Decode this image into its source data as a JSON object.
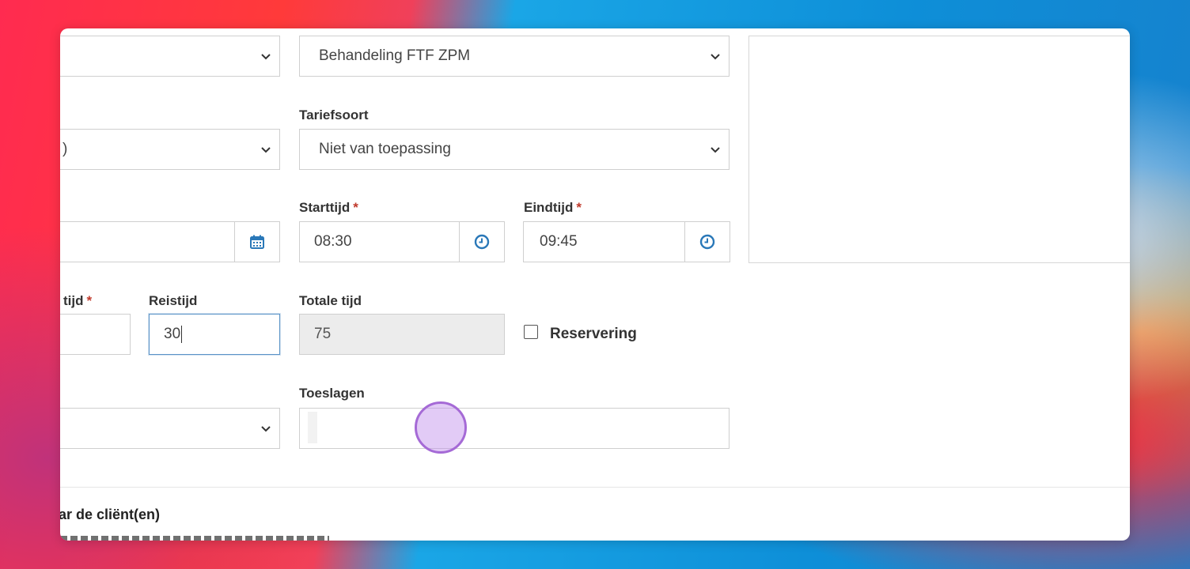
{
  "form": {
    "row1": {
      "left_select_value": "",
      "activity_select_value": "Behandeling FTF ZPM"
    },
    "row2": {
      "tariff_label": "Tariefsoort",
      "left_select_value": ")",
      "tariff_select_value": "Niet van toepassing"
    },
    "row3": {
      "date_value": "",
      "start_label": "Starttijd",
      "start_value": "08:30",
      "end_label": "Eindtijd",
      "end_value": "09:45",
      "required_mark": "*"
    },
    "row4": {
      "partial_label": "tijd",
      "travel_label": "Reistijd",
      "travel_value": "30",
      "total_label": "Totale tijd",
      "total_value": "75",
      "reservation_label": "Reservering",
      "required_mark": "*"
    },
    "row5": {
      "left_select_value": "",
      "surcharges_label": "Toeslagen",
      "surcharges_value": ""
    },
    "section": {
      "title_partial": "ar de cliënt(en)"
    }
  },
  "icons": {
    "chevron": "chevron-down-icon",
    "calendar": "calendar-icon",
    "clock": "clock-icon"
  },
  "colors": {
    "accent": "#2a78b8",
    "required": "#c0392b",
    "focus_border": "#5a93c7"
  }
}
